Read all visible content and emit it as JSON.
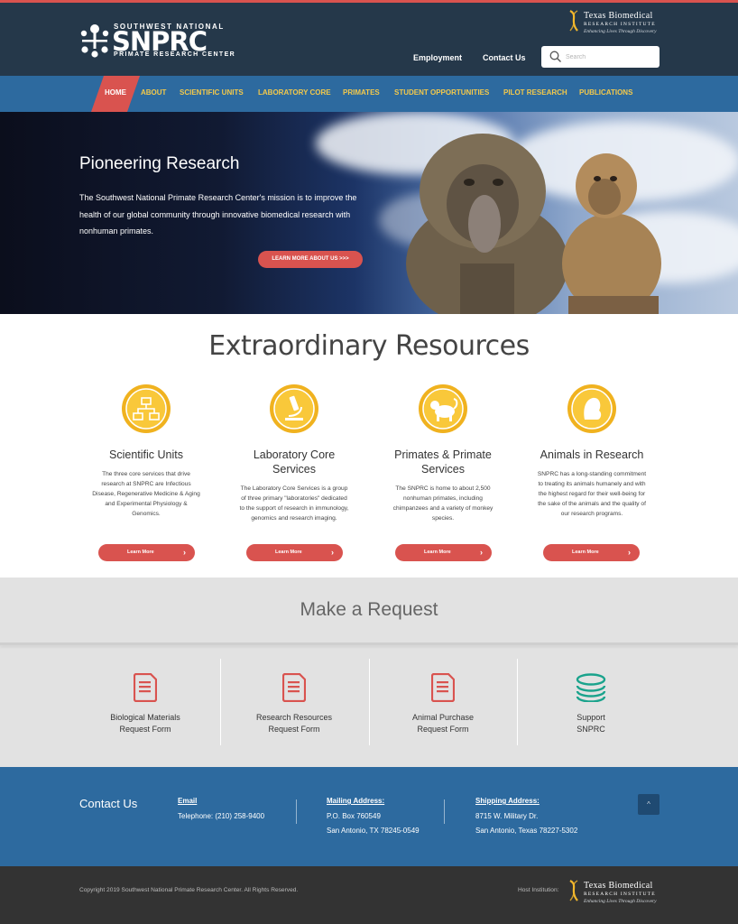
{
  "header": {
    "logo": {
      "top_text": "SOUTHWEST NATIONAL",
      "main_text": "SNPRC",
      "sub_text": "PRIMATE RESEARCH CENTER"
    },
    "partner": {
      "line1": "Texas Biomedical",
      "line2": "RESEARCH INSTITUTE",
      "line3": "Enhancing Lives Through Discovery"
    },
    "links": [
      "Employment",
      "Contact Us"
    ],
    "search": {
      "placeholder": "Search"
    }
  },
  "nav": {
    "items": [
      "HOME",
      "ABOUT",
      "SCIENTIFIC UNITS",
      "LABORATORY CORE",
      "PRIMATES",
      "STUDENT OPPORTUNITIES",
      "PILOT RESEARCH",
      "PUBLICATIONS"
    ],
    "active": "HOME"
  },
  "hero": {
    "title": "Pioneering Research",
    "text": "The Southwest National Primate Research Center's mission is to improve the health of our global community through innovative biomedical research with nonhuman primates.",
    "button": "LEARN MORE ABOUT US >>>"
  },
  "resources": {
    "title": "Extraordinary Resources",
    "button_label": "Learn More",
    "items": [
      {
        "name": "Scientific Units",
        "icon": "org-chart-icon",
        "desc": "The three core services that drive research at SNPRC are Infectious Disease, Regenerative Medicine & Aging and Experimental Physiology & Genomics."
      },
      {
        "name": "Laboratory Core Services",
        "icon": "microscope-icon",
        "desc": "The Laboratory Core Services is a group of three primary \"laboratories\" dedicated to the support of research in immunology, genomics and research imaging."
      },
      {
        "name": "Primates & Primate Services",
        "icon": "primate-icon",
        "desc": "The SNPRC is home to about 2,500 nonhuman primates, including chimpanzees and a variety of monkey species."
      },
      {
        "name": "Animals in Research",
        "icon": "animal-head-icon",
        "desc": "SNPRC has a long-standing commitment to treating its animals humanely and with the highest regard for their well-being for the sake of the animals and the quality of our research programs."
      }
    ]
  },
  "request": {
    "title": "Make a Request",
    "items": [
      {
        "label_line1": "Biological Materials",
        "label_line2": "Request Form",
        "icon": "form-document-icon"
      },
      {
        "label_line1": "Research Resources",
        "label_line2": "Request Form",
        "icon": "form-document-icon"
      },
      {
        "label_line1": "Animal Purchase",
        "label_line2": "Request Form",
        "icon": "form-document-icon"
      },
      {
        "label_line1": "Support",
        "label_line2": "SNPRC",
        "icon": "coin-stack-icon"
      }
    ]
  },
  "footer": {
    "title": "Contact Us",
    "email_label": "Email",
    "telephone": "Telephone: (210) 258-9400",
    "mailing_label": "Mailing Address:",
    "mailing_line1": "P.O. Box 760549",
    "mailing_line2": "San Antonio, TX 78245-0549",
    "shipping_label": "Shipping Address:",
    "shipping_line1": "8715 W. Military Dr.",
    "shipping_line2": "San Antonio, Texas 78227-5302"
  },
  "bottom": {
    "copyright": "Copyright 2019 Southwest National Primate Research Center. All Rights Reserved.",
    "host_label": "Host Institution:"
  },
  "colors": {
    "header_bg": "#25384a",
    "nav_bg": "#2d6a9f",
    "nav_text": "#f3c94b",
    "accent_red": "#d9534f",
    "icon_gold": "#f3b82c",
    "support_teal": "#1aa38c",
    "footer_bg": "#2d6a9f",
    "bottom_bg": "#333333"
  }
}
